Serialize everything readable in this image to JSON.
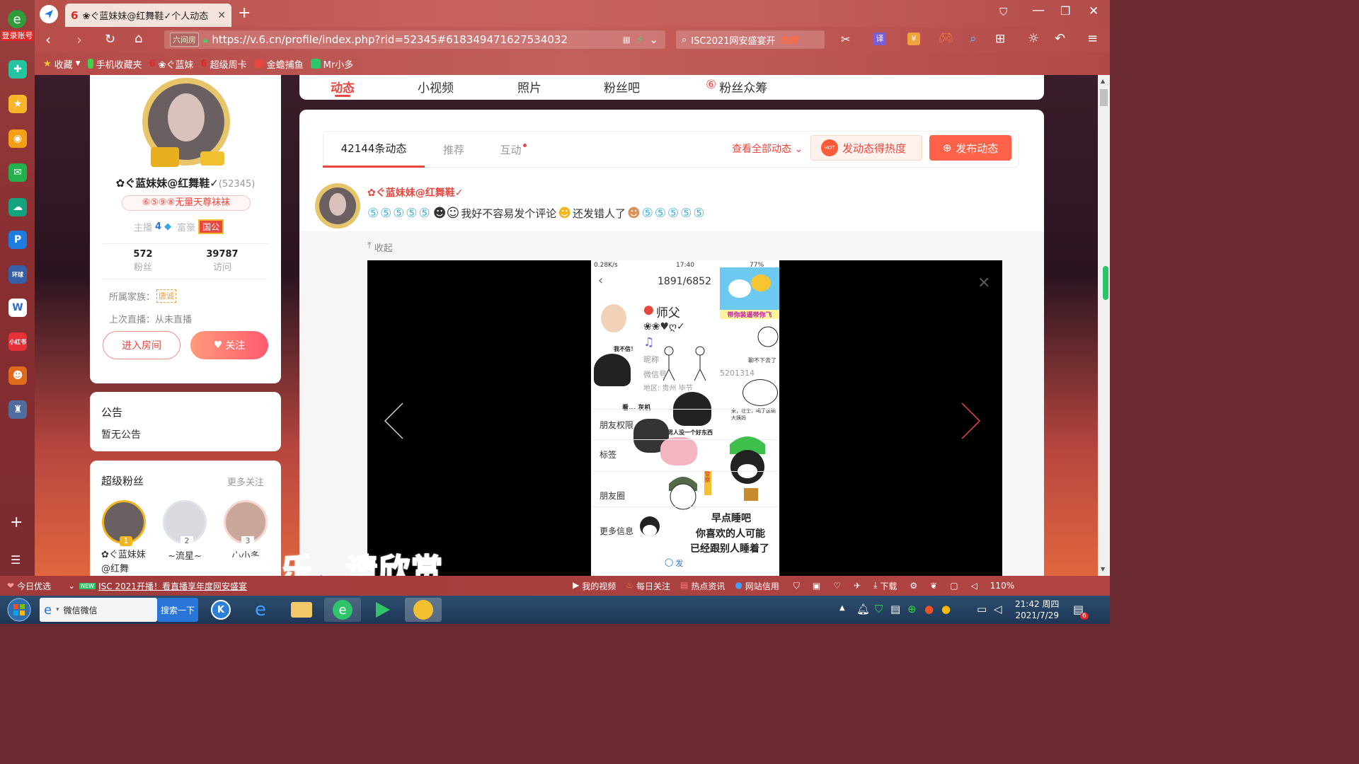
{
  "dock": {
    "login": "登录账号"
  },
  "tab": {
    "title": "❀ぐ蓝妹妹@红舞鞋✓个人动态"
  },
  "address": {
    "badge": "六间房",
    "url": "https://v.6.cn/profile/index.php?rid=52345#618349471627534032"
  },
  "search": {
    "text": "ISC2021网安盛宴开",
    "hot": "热搜"
  },
  "favorites": [
    "收藏",
    "手机收藏夹",
    "❀ぐ蓝妹",
    "超级周卡",
    "金蟾捕鱼",
    "Mr小多"
  ],
  "profile_nav": {
    "tabs": [
      "动态",
      "小视频",
      "照片",
      "粉丝吧",
      "粉丝众筹"
    ]
  },
  "profile": {
    "name": "✿ぐ蓝妹妹@红舞鞋✓",
    "rid": "(52345)",
    "title_badge": "⑥⑤⑨⑧无量天尊袜袜",
    "anchor_label": "主播",
    "anchor_level": "4",
    "rich_label": "富豪",
    "rich_badge": "国公",
    "fans_count": "572",
    "fans_label": "粉丝",
    "visits_count": "39787",
    "visits_label": "访问",
    "family_label": "所属家族：",
    "family_badge": "唐诚",
    "last_live": "上次直播：从未直播",
    "enter_room": "进入房间",
    "follow": "关注"
  },
  "notice": {
    "title": "公告",
    "text": "暂无公告"
  },
  "super_fans": {
    "title": "超级粉丝",
    "more": "更多关注",
    "fans": [
      {
        "rank": "1",
        "name": "✿ぐ蓝妹妹@红舞"
      },
      {
        "rank": "2",
        "name": "~流星~"
      },
      {
        "rank": "3",
        "name": "小小多"
      }
    ]
  },
  "feed": {
    "tabs": [
      "42144条动态",
      "推荐",
      "互动"
    ],
    "view_all": "查看全部动态",
    "boost": "发动态得热度",
    "publish": "发布动态",
    "hot_badge": "HOT"
  },
  "post": {
    "author": "✿ぐ蓝妹妹@红舞鞋✓",
    "text1": "我好不容易发个评论",
    "text2": "还发错人了",
    "collapse": "收起"
  },
  "phone": {
    "status_left": "0.28K/s",
    "time": "17:40",
    "battery": "77%",
    "counter": "1891/6852",
    "name": "师父",
    "sticker_top": "带你装逼带你飞",
    "nickname": "昵称",
    "wechat": "微信号",
    "wechat_tail": "5201314",
    "region": "地区: 贵州  毕节",
    "sticker_look": "看... 灰机",
    "sticker_men": "男人没一个好东西",
    "sticker_drink": "来，壮士，喝了这碗大姨妈",
    "sticker_cold": "我不信！",
    "sticker_stop": "聊不下去了",
    "friend_perm": "朋友权限",
    "tags": "标签",
    "moments": "朋友圈",
    "more_info": "更多信息",
    "sleep1": "早点睡吧",
    "sleep2": "你喜欢的人可能",
    "sleep3": "已经跟别人睡着了",
    "send": "发"
  },
  "overlay": {
    "subtitle": "纯音乐，请欣赏"
  },
  "statusbar": {
    "today": "今日优选",
    "news": "ISC 2021开播！看直播享年度网安盛宴",
    "items": [
      "我的视频",
      "每日关注",
      "热点资讯",
      "网站信用",
      "下载"
    ],
    "zoom": "110%"
  },
  "taskbar": {
    "ie_label": "微信微信",
    "search_btn": "搜索一下",
    "time": "21:42 周四",
    "date": "2021/7/29",
    "notif": "6"
  }
}
